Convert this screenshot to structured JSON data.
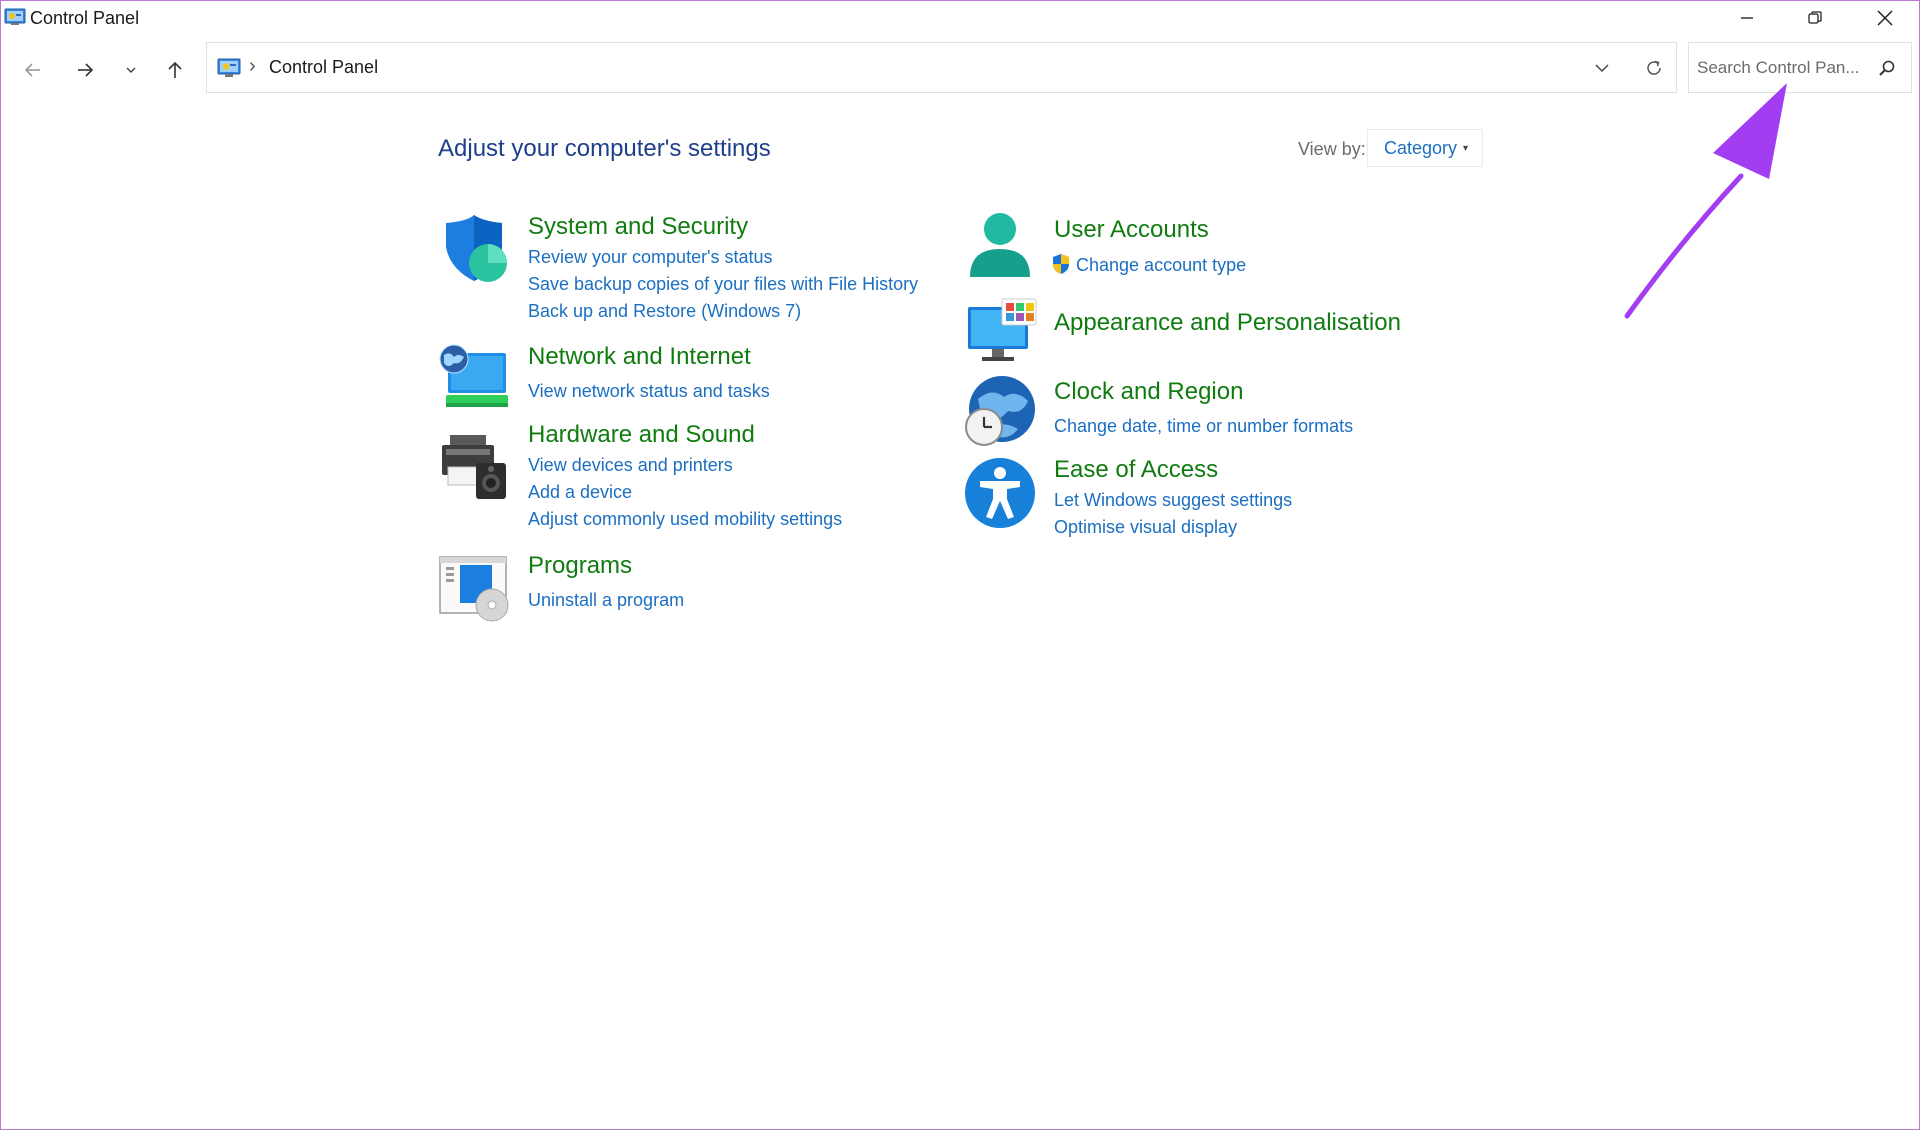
{
  "window": {
    "title": "Control Panel"
  },
  "address": {
    "crumb_sep": "›",
    "crumb": "Control Panel"
  },
  "search": {
    "placeholder": "Search Control Pan..."
  },
  "content": {
    "heading": "Adjust your computer's settings",
    "view_by_label": "View by:",
    "view_by_value": "Category"
  },
  "categories": {
    "system_security": {
      "title": "System and Security",
      "links": [
        "Review your computer's status",
        "Save backup copies of your files with File History",
        "Back up and Restore (Windows 7)"
      ]
    },
    "network": {
      "title": "Network and Internet",
      "links": [
        "View network status and tasks"
      ]
    },
    "hardware": {
      "title": "Hardware and Sound",
      "links": [
        "View devices and printers",
        "Add a device",
        "Adjust commonly used mobility settings"
      ]
    },
    "programs": {
      "title": "Programs",
      "links": [
        "Uninstall a program"
      ]
    },
    "user_accounts": {
      "title": "User Accounts",
      "links": [
        "Change account type"
      ]
    },
    "appearance": {
      "title": "Appearance and Personalisation"
    },
    "clock": {
      "title": "Clock and Region",
      "links": [
        "Change date, time or number formats"
      ]
    },
    "ease": {
      "title": "Ease of Access",
      "links": [
        "Let Windows suggest settings",
        "Optimise visual display"
      ]
    }
  },
  "colors": {
    "category_green": "#107c10",
    "link_blue": "#1b6fc2",
    "heading_blue": "#1e3f8a",
    "annotation_arrow": "#a33df2"
  },
  "icons": {
    "window": "control-panel-icon",
    "system_security": "shield-icon",
    "network": "network-globe-monitor-icon",
    "hardware": "printer-speaker-icon",
    "programs": "programs-disc-icon",
    "user_accounts": "user-icon",
    "appearance": "monitor-palette-icon",
    "clock": "globe-clock-icon",
    "ease": "accessibility-icon",
    "uac": "uac-shield-icon"
  }
}
